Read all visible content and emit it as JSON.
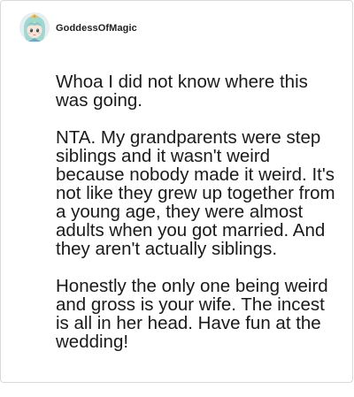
{
  "post": {
    "username": "GoddessOfMagic",
    "paragraphs": [
      "Whoa I did not know where this was going.",
      "NTA. My grandparents were step siblings and it wasn't weird because nobody made it weird. It's not like they grew up together from a young age, they were almost adults when you got married. And they aren't actually siblings.",
      "Honestly the only one being weird and gross is your wife. The incest is all in her head. Have fun at the wedding!"
    ]
  }
}
